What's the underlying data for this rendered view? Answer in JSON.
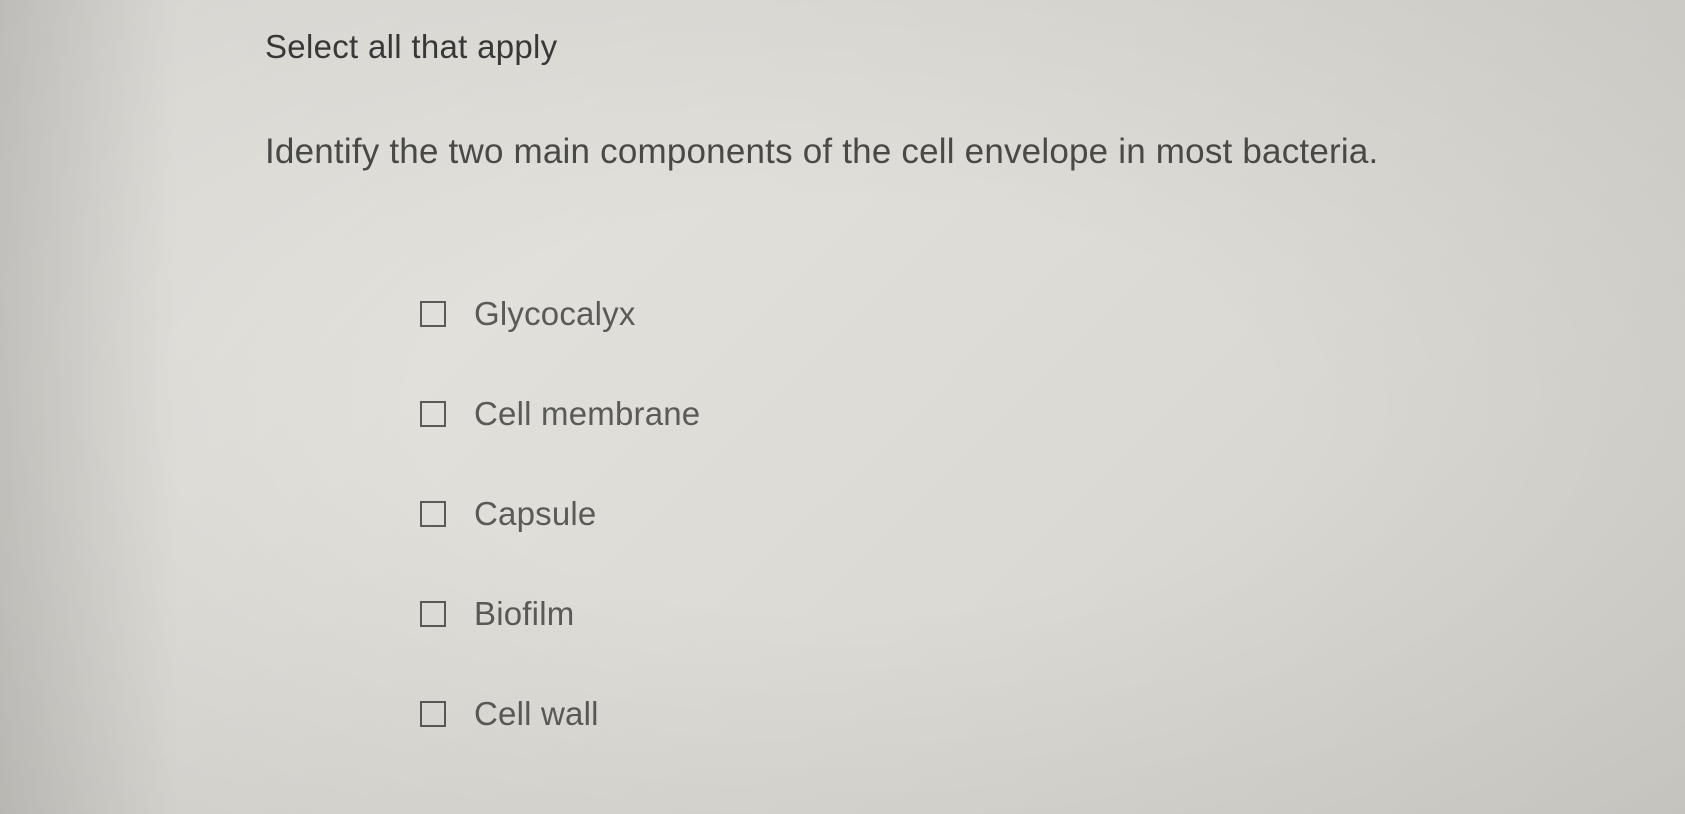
{
  "instruction": "Select all that apply",
  "question": "Identify the two main components of the cell envelope in most bacteria.",
  "options": [
    {
      "label": "Glycocalyx"
    },
    {
      "label": "Cell membrane"
    },
    {
      "label": "Capsule"
    },
    {
      "label": "Biofilm"
    },
    {
      "label": "Cell wall"
    }
  ]
}
